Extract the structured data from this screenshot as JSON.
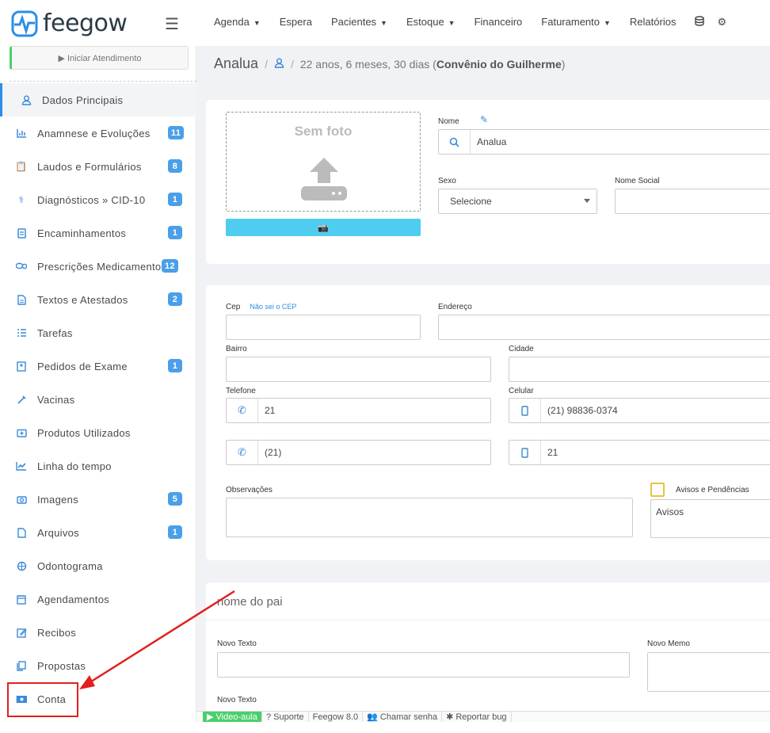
{
  "app": {
    "logo_text": "feegow"
  },
  "nav": {
    "items": [
      {
        "label": "Agenda",
        "has_caret": true
      },
      {
        "label": "Espera",
        "has_caret": false
      },
      {
        "label": "Pacientes",
        "has_caret": true
      },
      {
        "label": "Estoque",
        "has_caret": true
      },
      {
        "label": "Financeiro",
        "has_caret": false
      },
      {
        "label": "Faturamento",
        "has_caret": true
      },
      {
        "label": "Relatórios",
        "has_caret": false
      }
    ],
    "icons": [
      "database-icon",
      "gear-icon"
    ]
  },
  "sidebar": {
    "start_button": "▶ Iniciar Atendimento",
    "items": [
      {
        "label": "Dados Principais",
        "icon": "user-icon",
        "badge": ""
      },
      {
        "label": "Anamnese e Evoluções",
        "icon": "chart-icon",
        "badge": "11"
      },
      {
        "label": "Laudos e Formulários",
        "icon": "clipboard-icon",
        "badge": "8"
      },
      {
        "label": "Diagnósticos » CID-10",
        "icon": "stethoscope-icon",
        "badge": "1"
      },
      {
        "label": "Encaminhamentos",
        "icon": "document-icon",
        "badge": "1"
      },
      {
        "label": "Prescrições Medicamentos",
        "icon": "pills-icon",
        "badge": "12"
      },
      {
        "label": "Textos e Atestados",
        "icon": "file-text-icon",
        "badge": "2"
      },
      {
        "label": "Tarefas",
        "icon": "tasks-icon",
        "badge": ""
      },
      {
        "label": "Pedidos de Exame",
        "icon": "hospital-icon",
        "badge": "1"
      },
      {
        "label": "Vacinas",
        "icon": "syringe-icon",
        "badge": ""
      },
      {
        "label": "Produtos Utilizados",
        "icon": "medkit-icon",
        "badge": ""
      },
      {
        "label": "Linha do tempo",
        "icon": "line-chart-icon",
        "badge": ""
      },
      {
        "label": "Imagens",
        "icon": "camera-icon",
        "badge": "5"
      },
      {
        "label": "Arquivos",
        "icon": "file-icon",
        "badge": "1"
      },
      {
        "label": "Odontograma",
        "icon": "tooth-icon",
        "badge": ""
      },
      {
        "label": "Agendamentos",
        "icon": "calendar-icon",
        "badge": ""
      },
      {
        "label": "Recibos",
        "icon": "edit-icon",
        "badge": ""
      },
      {
        "label": "Propostas",
        "icon": "copy-icon",
        "badge": ""
      },
      {
        "label": "Conta",
        "icon": "money-icon",
        "badge": ""
      }
    ]
  },
  "breadcrumb": {
    "patient": "Analua",
    "age": "22 anos, 6 meses, 30 dias (",
    "insurance": "Convênio do Guilherme",
    "close": " )"
  },
  "form": {
    "photo_label": "Sem foto",
    "name_label": "Nome",
    "name_value": "Analua",
    "sex_label": "Sexo",
    "sex_value": "Selecione",
    "social_name_label": "Nome Social",
    "cep_label": "Cep",
    "cep_link": "Não sei o CEP",
    "address_label": "Endereço",
    "district_label": "Bairro",
    "city_label": "Cidade",
    "phone_label": "Telefone",
    "phone1": "21",
    "phone2": "(21)",
    "cell_label": "Celular",
    "cell1": "(21) 98836-0374",
    "cell2": "21",
    "notes_label": "Observações",
    "warnings_label": "Avisos e Pendências",
    "warnings_value": "Avisos",
    "father_title": "nome do pai",
    "new_text_label": "Novo Texto",
    "new_memo_label": "Novo Memo",
    "new_text2_label": "Novo Texto"
  },
  "bottombar": {
    "video": "Video-aula",
    "support": "Suporte",
    "version": "Feegow 8.0",
    "call": "Chamar senha",
    "bug": "Reportar bug"
  },
  "colors": {
    "accent": "#2a8fe6",
    "badge": "#4a9fe8",
    "annotation": "#e0201f",
    "camera_button": "#4fcdf0"
  }
}
